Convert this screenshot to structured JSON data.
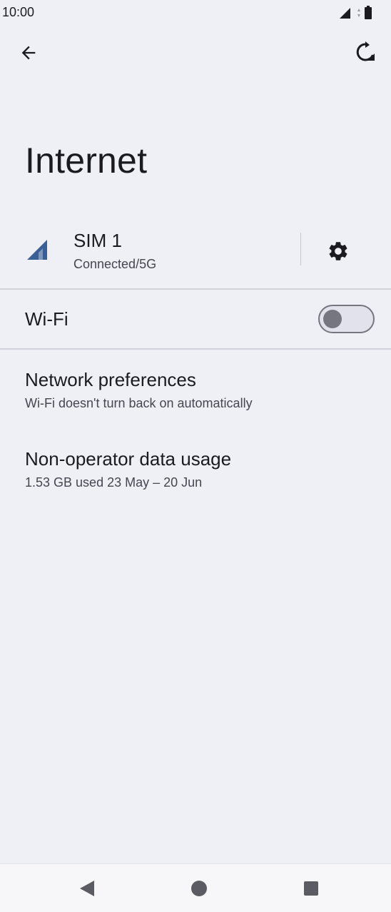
{
  "status_bar": {
    "time": "10:00"
  },
  "header": {
    "title": "Internet"
  },
  "sim": {
    "name": "SIM 1",
    "status": "Connected/5G"
  },
  "wifi": {
    "label": "Wi-Fi",
    "enabled": false
  },
  "items": [
    {
      "title": "Network preferences",
      "subtitle": "Wi-Fi doesn't turn back on automatically"
    },
    {
      "title": "Non-operator data usage",
      "subtitle": "1.53 GB used 23 May – 20 Jun"
    }
  ],
  "icons": {
    "back": "arrow-left-icon",
    "reset": "network-reset-icon",
    "signal": "cellular-signal-icon",
    "settings": "gear-icon",
    "nav_back": "triangle-back-icon",
    "nav_home": "circle-home-icon",
    "nav_recents": "square-recents-icon"
  },
  "colors": {
    "background": "#eff0f6",
    "signal_accent": "#3a5f95",
    "toggle_off": "#767680"
  }
}
